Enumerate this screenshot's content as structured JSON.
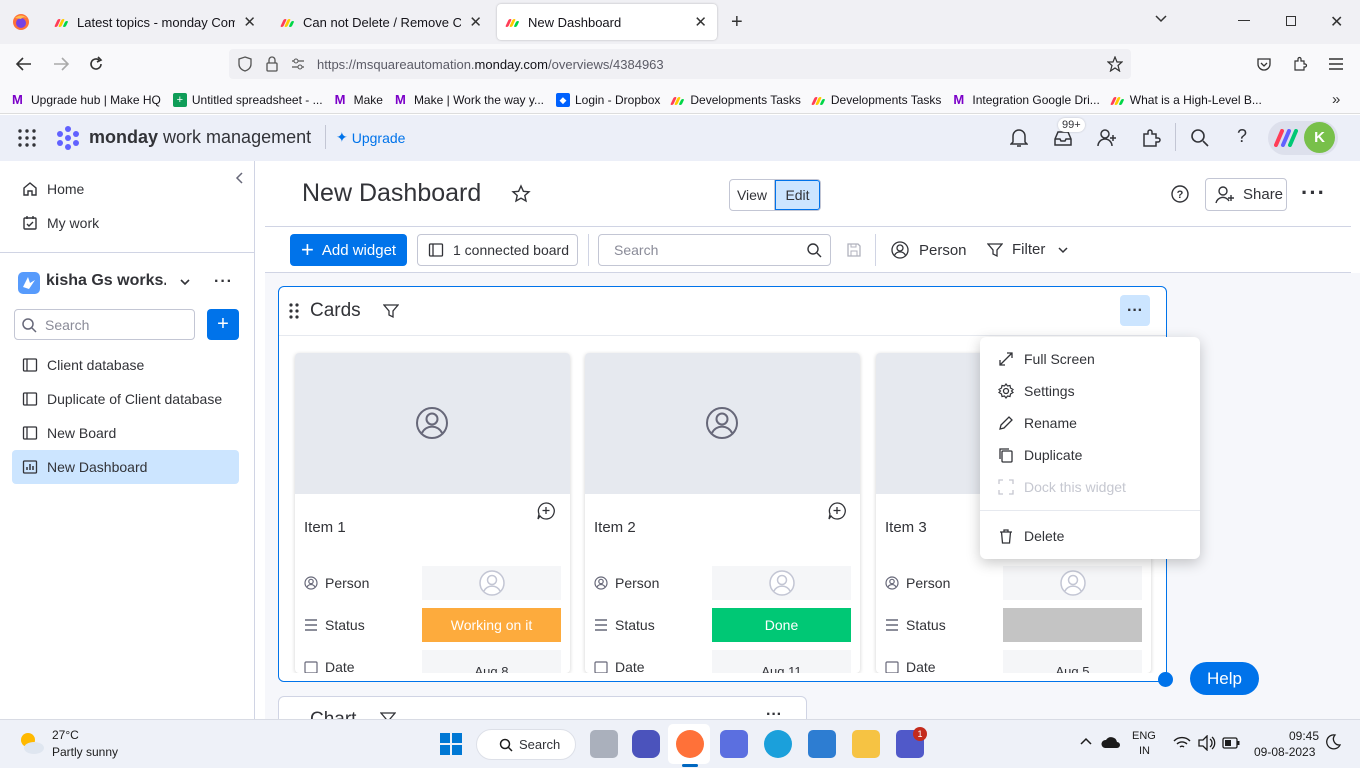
{
  "browser": {
    "tabs": [
      {
        "title": "Latest topics - monday Commu",
        "active": false
      },
      {
        "title": "Can not Delete / Remove Cards",
        "active": false
      },
      {
        "title": "New Dashboard",
        "active": true
      }
    ],
    "url_prefix": "https://msquareautomation.",
    "url_domain": "monday.com",
    "url_path": "/overviews/4384963",
    "bookmarks": [
      "Upgrade hub | Make HQ",
      "Untitled spreadsheet - ...",
      "Make",
      "Make | Work the way y...",
      "Login - Dropbox",
      "Developments Tasks",
      "Developments Tasks",
      "Integration Google Dri...",
      "What is a High-Level B..."
    ]
  },
  "header": {
    "brand": "monday",
    "brand_sub": "work management",
    "upgrade": "Upgrade",
    "inbox_badge": "99+",
    "avatar_letter": "K"
  },
  "sidebar": {
    "home": "Home",
    "my_work": "My work",
    "workspace": "kisha Gs works...",
    "search_placeholder": "Search",
    "items": [
      {
        "label": "Client database",
        "icon": "board-icon",
        "selected": false
      },
      {
        "label": "Duplicate of Client database",
        "icon": "board-icon",
        "selected": false
      },
      {
        "label": "New Board",
        "icon": "board-icon",
        "selected": false
      },
      {
        "label": "New Dashboard",
        "icon": "dashboard-icon",
        "selected": true
      }
    ]
  },
  "dashboard": {
    "title": "New Dashboard",
    "view": "View",
    "edit": "Edit",
    "share": "Share",
    "add_widget": "Add widget",
    "connected": "1 connected board",
    "search_placeholder": "Search",
    "person": "Person",
    "filter": "Filter"
  },
  "widget": {
    "title": "Cards",
    "cards": [
      {
        "name": "Item 1",
        "status": "Working on it",
        "status_color": "#fdab3d",
        "date": "Aug 8"
      },
      {
        "name": "Item 2",
        "status": "Done",
        "status_color": "#00c875",
        "date": "Aug 11"
      },
      {
        "name": "Item 3",
        "status": "",
        "status_color": "#c4c4c4",
        "date": "Aug 5"
      }
    ],
    "labels": {
      "person": "Person",
      "status": "Status",
      "date": "Date"
    }
  },
  "menu": {
    "items": [
      {
        "label": "Full Screen",
        "icon": "expand-icon",
        "disabled": false
      },
      {
        "label": "Settings",
        "icon": "gear-icon",
        "disabled": false
      },
      {
        "label": "Rename",
        "icon": "pencil-icon",
        "disabled": false
      },
      {
        "label": "Duplicate",
        "icon": "copy-icon",
        "disabled": false
      },
      {
        "label": "Dock this widget",
        "icon": "dock-icon",
        "disabled": true
      },
      {
        "label": "Delete",
        "icon": "trash-icon",
        "disabled": false
      }
    ]
  },
  "chart_widget_title": "Chart",
  "help": "Help",
  "taskbar": {
    "temp": "27°C",
    "weather": "Partly sunny",
    "search": "Search",
    "lang1": "ENG",
    "lang2": "IN",
    "time": "09:45",
    "date": "09-08-2023",
    "teams_badge": "1"
  }
}
